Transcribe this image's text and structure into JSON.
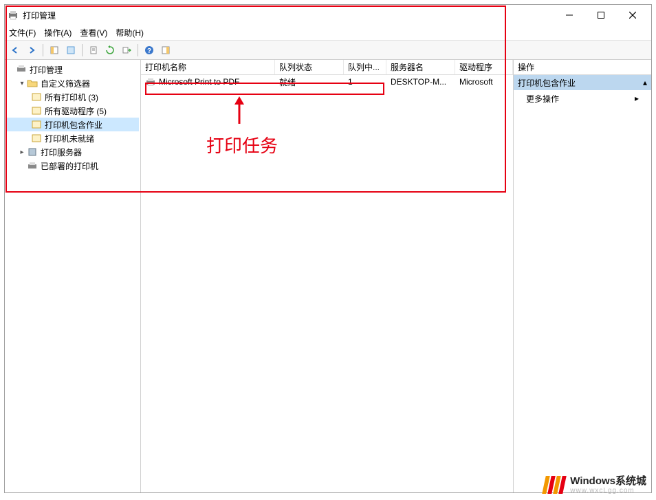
{
  "window": {
    "title": "打印管理"
  },
  "menu": {
    "file": "文件(F)",
    "action": "操作(A)",
    "view": "查看(V)",
    "help": "帮助(H)"
  },
  "tree": {
    "root": "打印管理",
    "custom_filters": "自定义筛选器",
    "all_printers": "所有打印机 (3)",
    "all_drivers": "所有驱动程序 (5)",
    "printers_with_jobs": "打印机包含作业",
    "printers_not_ready": "打印机未就绪",
    "print_servers": "打印服务器",
    "deployed_printers": "已部署的打印机"
  },
  "list": {
    "columns": {
      "name": "打印机名称",
      "queue_status": "队列状态",
      "jobs_in_queue": "队列中...",
      "server_name": "服务器名",
      "driver": "驱动程序"
    },
    "rows": [
      {
        "name": "Microsoft Print to PDF",
        "queue_status": "就绪",
        "jobs_in_queue": "1",
        "server_name": "DESKTOP-M...",
        "driver": "Microsoft"
      }
    ]
  },
  "actions": {
    "header": "操作",
    "selected": "打印机包含作业",
    "more": "更多操作"
  },
  "annotation": {
    "label": "打印任务"
  },
  "watermark": {
    "line1": "Windows系统城",
    "line2": "www.wxcLgg.com"
  }
}
